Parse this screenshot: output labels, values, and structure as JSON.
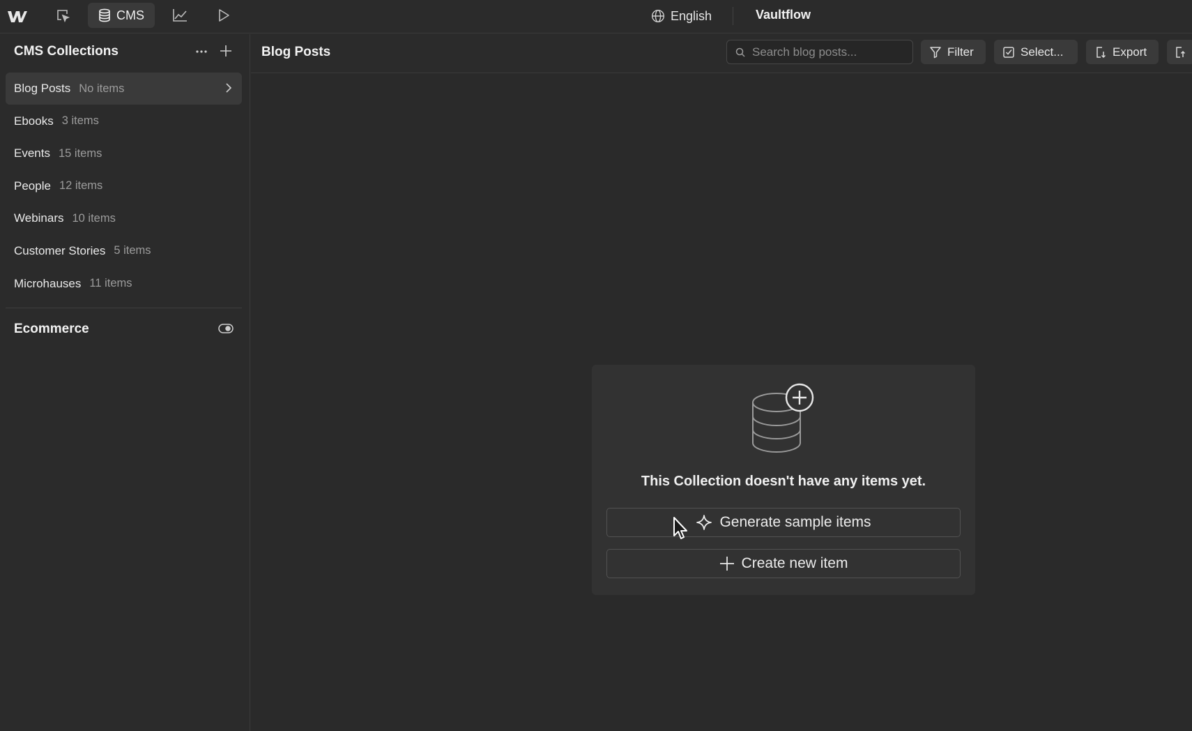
{
  "topbar": {
    "nav": [
      {
        "id": "designer",
        "icon": "designer-cursor-icon"
      },
      {
        "id": "cms",
        "label": "CMS",
        "icon": "database-icon",
        "active": true
      },
      {
        "id": "analytics",
        "icon": "chart-icon"
      },
      {
        "id": "preview",
        "icon": "play-icon"
      }
    ],
    "locale": "English",
    "site_name": "Vaultflow"
  },
  "sidebar": {
    "title": "CMS Collections",
    "collections": [
      {
        "name": "Blog Posts",
        "count": "No items",
        "selected": true
      },
      {
        "name": "Ebooks",
        "count": "3 items"
      },
      {
        "name": "Events",
        "count": "15 items"
      },
      {
        "name": "People",
        "count": "12 items"
      },
      {
        "name": "Webinars",
        "count": "10 items"
      },
      {
        "name": "Customer Stories",
        "count": "5 items"
      },
      {
        "name": "Microhauses",
        "count": "11 items"
      }
    ],
    "ecommerce": {
      "label": "Ecommerce",
      "visible": true
    }
  },
  "main": {
    "title": "Blog Posts",
    "search_placeholder": "Search blog posts...",
    "buttons": {
      "filter": "Filter",
      "select": "Select...",
      "export": "Export"
    },
    "empty_state": {
      "message": "This Collection doesn't have any items yet.",
      "generate_label": "Generate sample items",
      "create_label": "Create new item"
    }
  },
  "colors": {
    "background": "#2a2a2a",
    "panel": "#2b2b2b",
    "card": "#323232",
    "active_item": "#3a3a3a",
    "text": "#e8e8e8",
    "muted_text": "#9c9c9c"
  }
}
